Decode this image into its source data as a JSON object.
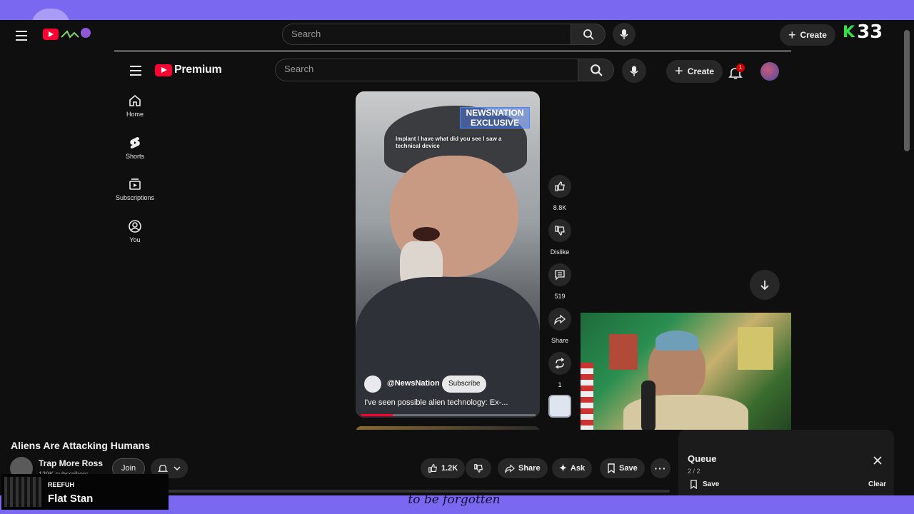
{
  "outer": {
    "search_placeholder": "Search",
    "create_label": "Create",
    "overlay_logo": "33"
  },
  "inner": {
    "logo_text": "Premium",
    "search_placeholder": "Search",
    "create_label": "Create",
    "notification_count": "1",
    "sidebar": [
      {
        "label": "Home",
        "icon": "home-icon"
      },
      {
        "label": "Shorts",
        "icon": "shorts-icon"
      },
      {
        "label": "Subscriptions",
        "icon": "subscriptions-icon"
      },
      {
        "label": "You",
        "icon": "you-icon"
      }
    ]
  },
  "short": {
    "badge_line1": "NEWSNATION",
    "badge_line2": "EXCLUSIVE",
    "caption": "Implant I have what did you see I saw a technical device",
    "channel": "@NewsNation",
    "subscribe_label": "Subscribe",
    "title": "I've seen possible alien technology: Ex-...",
    "progress": 0.18,
    "actions": {
      "like_count": "8.8K",
      "dislike_label": "Dislike",
      "comment_count": "519",
      "share_label": "Share",
      "remix_count": "1"
    }
  },
  "video": {
    "title": "Aliens Are Attacking Humans",
    "channel": "Trap More Ross",
    "subscribers": "129K subscribers",
    "join_label": "Join",
    "like_count": "1.2K",
    "share_label": "Share",
    "ask_label": "Ask",
    "save_label": "Save"
  },
  "queue": {
    "title": "Queue",
    "position": "2 / 2",
    "save_label": "Save",
    "clear_label": "Clear"
  },
  "stream_overlay": {
    "small_label": "REEFUH",
    "name": "Flat Stan",
    "subtitle": "to be forgotten"
  },
  "colors": {
    "accent_purple": "#7b68f0",
    "youtube_red": "#ff0033",
    "overlay_green": "#35e04a"
  }
}
